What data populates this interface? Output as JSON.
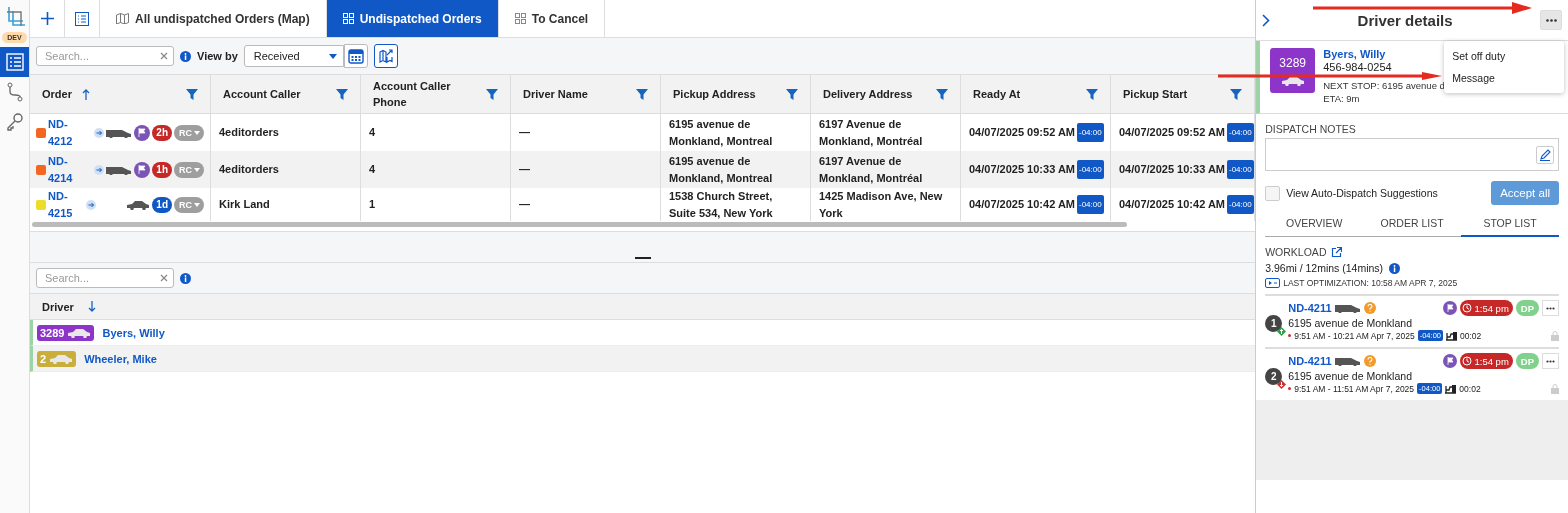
{
  "rail": {
    "badge": "DEV",
    "items": [
      {
        "selected": true
      },
      {
        "selected": false
      },
      {
        "selected": false
      }
    ]
  },
  "tabs": [
    {
      "label": "All undispatched Orders (Map)",
      "selected": false
    },
    {
      "label": "Undispatched Orders",
      "selected": true
    },
    {
      "label": "To Cancel",
      "selected": false
    }
  ],
  "orders_toolbar": {
    "search": {
      "placeholder": "Search..."
    },
    "view_by_label": "View by",
    "view_by": "Received"
  },
  "orders_table": {
    "columns": [
      {
        "label": "Order",
        "sorted": true
      },
      {
        "label": "Account Caller",
        "sorted": false
      },
      {
        "label": "Account Caller Phone",
        "sorted": false
      },
      {
        "label": "Driver Name",
        "sorted": false
      },
      {
        "label": "Pickup Address",
        "sorted": false
      },
      {
        "label": "Delivery Address",
        "sorted": false
      },
      {
        "label": "Ready At",
        "sorted": false
      },
      {
        "label": "Pickup Start",
        "sorted": false
      }
    ],
    "rows": [
      {
        "status": {
          "color": "#f26522"
        },
        "order": "ND-4212",
        "vehicle": {
          "kind": "van"
        },
        "flag": true,
        "age": {
          "label": "2h",
          "color": "#c62828"
        },
        "tag": "RC",
        "account_caller": "4editorders",
        "phone": "4",
        "driver": "—",
        "pickup": "6195 avenue de Monkland, Montreal",
        "delivery": "6197 Avenue de Monkland, Montréal",
        "ready_at": "04/07/2025 09:52 AM",
        "ready_tz": "-04:00",
        "pickup_start": "04/07/2025 09:52 AM",
        "pickup_tz": "-04:00"
      },
      {
        "status": {
          "color": "#f26522"
        },
        "order": "ND-4214",
        "vehicle": {
          "kind": "van"
        },
        "flag": true,
        "age": {
          "label": "1h",
          "color": "#c62828"
        },
        "tag": "RC",
        "account_caller": "4editorders",
        "phone": "4",
        "driver": "—",
        "pickup": "6195 avenue de Monkland, Montreal",
        "delivery": "6197 Avenue de Monkland, Montréal",
        "ready_at": "04/07/2025 10:33 AM",
        "ready_tz": "-04:00",
        "pickup_start": "04/07/2025 10:33 AM",
        "pickup_tz": "-04:00"
      },
      {
        "status": {
          "color": "#eedc2a"
        },
        "order": "ND-4215",
        "vehicle": {
          "kind": "car"
        },
        "flag": false,
        "age": {
          "label": "1d",
          "color": "#1158c7"
        },
        "tag": "RC",
        "account_caller": "Kirk Land",
        "phone": "1",
        "driver": "—",
        "pickup": "1538 Church Street, Suite 534, New York",
        "delivery": "1425 Madison Ave, New York",
        "ready_at": "04/07/2025 10:42 AM",
        "ready_tz": "-04:00",
        "pickup_start": "04/07/2025 10:42 AM",
        "pickup_tz": "-04:00"
      }
    ]
  },
  "drivers_toolbar": {
    "search": {
      "placeholder": "Search..."
    }
  },
  "drivers_table": {
    "column": "Driver",
    "rows": [
      {
        "number": "3289",
        "color": "#8e35c9",
        "name": "Byers, Willy"
      },
      {
        "number": "2",
        "color": "#c9ae3c",
        "name": "Wheeler, Mike"
      }
    ]
  },
  "driver_details": {
    "title": "Driver details",
    "driver": {
      "number": "3289",
      "color": "#8e35c9",
      "name": "Byers, Willy",
      "phone": "456-984-0254",
      "next_stop": "NEXT STOP: 6195 avenue d",
      "eta": "ETA: 9m"
    },
    "menu": [
      "Set off duty",
      "Message"
    ],
    "notes_label": "DISPATCH NOTES",
    "auto_dispatch": {
      "label": "View Auto-Dispatch Suggestions",
      "checked": false
    },
    "accept_all": "Accept all",
    "tabs": [
      {
        "label": "OVERVIEW",
        "selected": false
      },
      {
        "label": "ORDER LIST",
        "selected": false
      },
      {
        "label": "STOP LIST",
        "selected": true
      }
    ],
    "workload_label": "WORKLOAD",
    "workload": "3.96mi / 12mins (14mins)",
    "last_optimization": "LAST OPTIMIZATION: 10:58 AM APR 7, 2025",
    "stops": [
      {
        "number": "1",
        "kind": "pickup",
        "order": "ND-4211",
        "time_badge": "1:54 pm",
        "tag": "DP",
        "address": "6195 avenue de Monkland",
        "window": "9:51 AM - 10:21 AM Apr 7, 2025",
        "tz": "-04:00",
        "duration": "00:02"
      },
      {
        "number": "2",
        "kind": "delivery",
        "order": "ND-4211",
        "time_badge": "1:54 pm",
        "tag": "DP",
        "address": "6195 avenue de Monkland",
        "window": "9:51 AM - 11:51 AM Apr 7, 2025",
        "tz": "-04:00",
        "duration": "00:02"
      }
    ]
  }
}
